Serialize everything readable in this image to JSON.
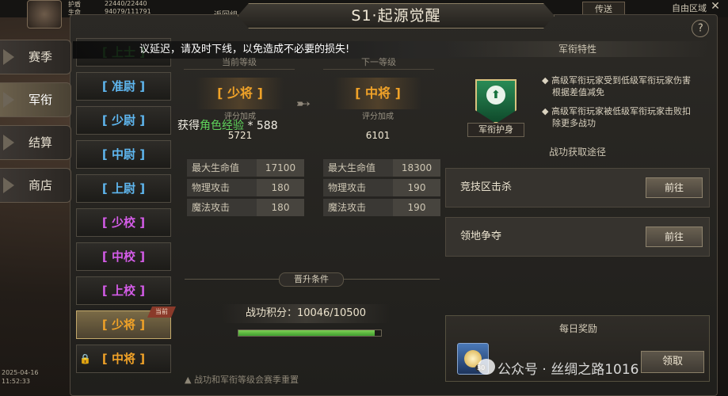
{
  "topbar": {
    "hp_label": "护盾",
    "hp_value": "22440/22440",
    "mp_label": "生命",
    "mp_value": "94079/111791",
    "return_label": "返回组",
    "transfer": "传送",
    "free_zone": "自由区域",
    "close": "✕"
  },
  "sidebar": [
    {
      "label": "赛季",
      "active": false
    },
    {
      "label": "军衔",
      "active": true
    },
    {
      "label": "结算",
      "active": false
    },
    {
      "label": "商店",
      "active": false
    }
  ],
  "title": "S1·起源觉醒",
  "help": "?",
  "marquee": "议延迟，请及时下线，以免造成不必要的损失!",
  "ranks": [
    {
      "label": "[ 上士 ]",
      "color": "#48d64a"
    },
    {
      "label": "[ 准尉 ]",
      "color": "#5fb7f0"
    },
    {
      "label": "[ 少尉 ]",
      "color": "#5fb7f0"
    },
    {
      "label": "[ 中尉 ]",
      "color": "#5fb7f0"
    },
    {
      "label": "[ 上尉 ]",
      "color": "#5fb7f0"
    },
    {
      "label": "[ 少校 ]",
      "color": "#d45ce8"
    },
    {
      "label": "[ 中校 ]",
      "color": "#d45ce8"
    },
    {
      "label": "[ 上校 ]",
      "color": "#d45ce8"
    },
    {
      "label": "[ 少将 ]",
      "color": "#f0a228"
    },
    {
      "label": "[ 中将 ]",
      "color": "#f0a228"
    }
  ],
  "current_badge": "当前",
  "current": {
    "head": "当前等级",
    "rank": "[ 少将 ]",
    "sub": "评分加成",
    "score": "5721"
  },
  "next": {
    "head": "下一等级",
    "rank": "[ 中将 ]",
    "sub": "评分加成",
    "score": "6101"
  },
  "gain": {
    "prefix": "获得",
    "item": "角色经验",
    "suffix": "* 588"
  },
  "stats_current": [
    {
      "k": "最大生命值",
      "v": "17100"
    },
    {
      "k": "物理攻击",
      "v": "180"
    },
    {
      "k": "魔法攻击",
      "v": "180"
    }
  ],
  "stats_next": [
    {
      "k": "最大生命值",
      "v": "18300"
    },
    {
      "k": "物理攻击",
      "v": "190"
    },
    {
      "k": "魔法攻击",
      "v": "190"
    }
  ],
  "promo": {
    "label": "晋升条件",
    "points_text": "战功积分：10046/10500",
    "progress": 0.957
  },
  "note": "▲ 战功和军衔等级会赛季重置",
  "traits": {
    "head": "军衔特性",
    "badge": "军衔护身",
    "lines": [
      "◆ 高级军衔玩家受到低级军衔玩家伤害",
      "根据差值减免",
      "◆ 高级军衔玩家被低级军衔玩家击败扣",
      "除更多战功"
    ]
  },
  "sources": {
    "head": "战功获取途径",
    "items": [
      {
        "label": "竞技区击杀",
        "button": "前往"
      },
      {
        "label": "领地争夺",
        "button": "前往"
      }
    ]
  },
  "daily": {
    "head": "每日奖励",
    "count": "30",
    "claim": "领取"
  },
  "watermark": "公众号 · 丝绸之路1016",
  "clock": {
    "date": "2025-04-16",
    "time": "11:52:33"
  }
}
